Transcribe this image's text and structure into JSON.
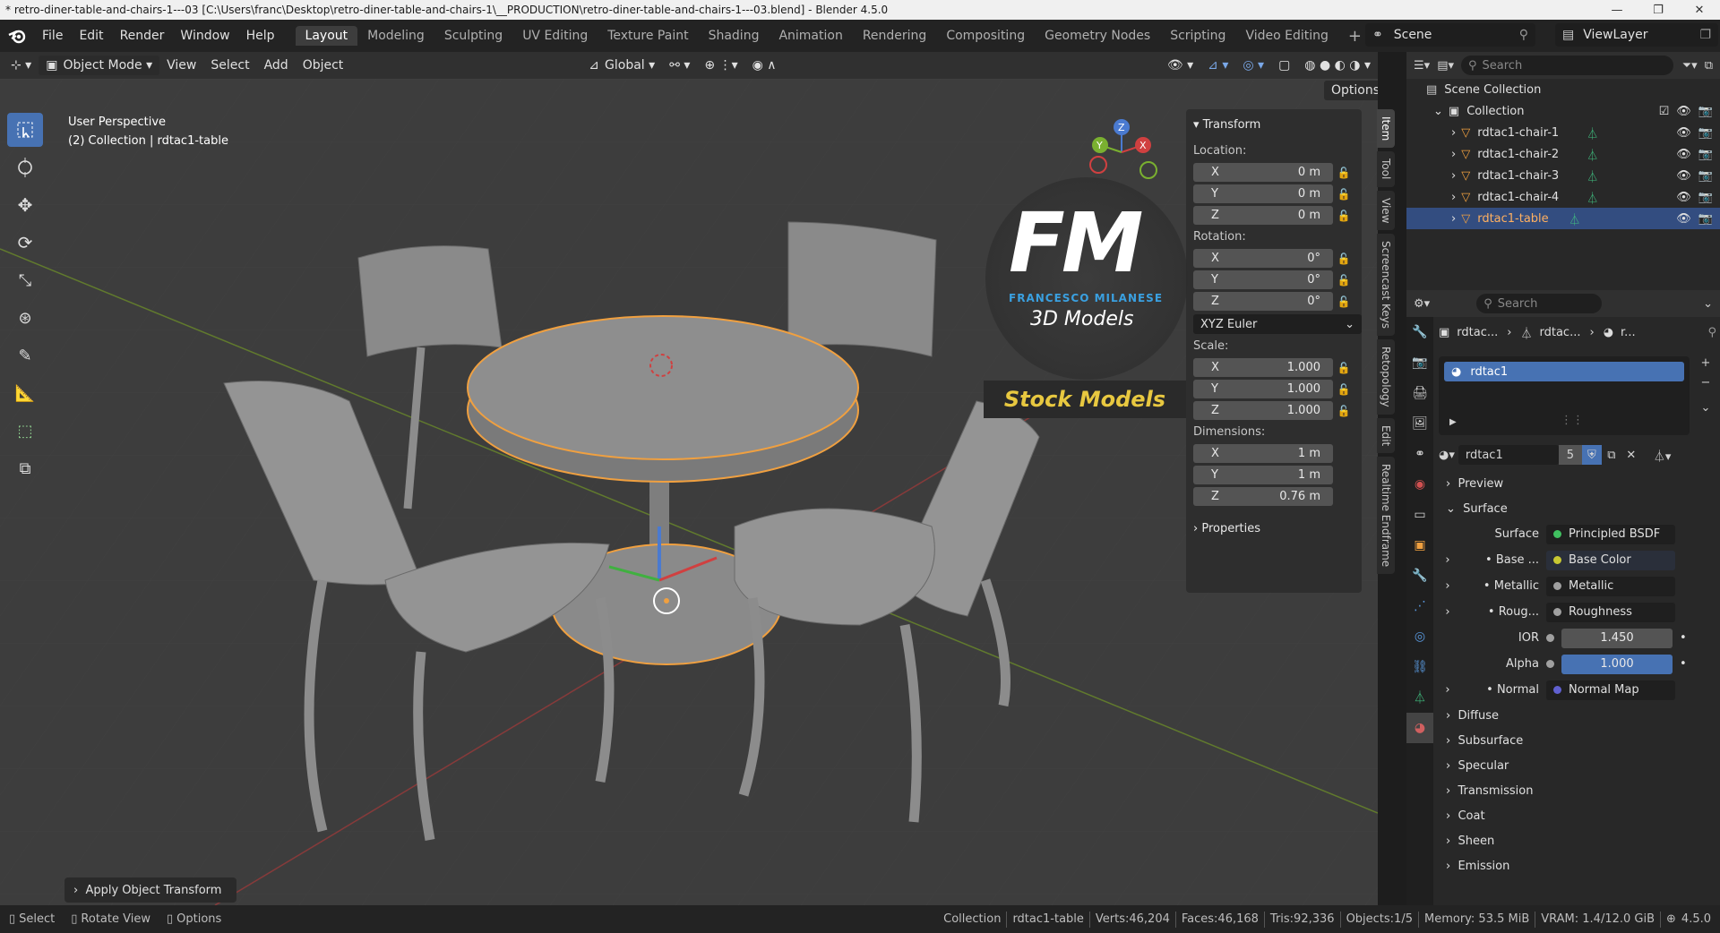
{
  "window": {
    "title": "* retro-diner-table-and-chairs-1---03 [C:\\Users\\franc\\Desktop\\retro-diner-table-and-chairs-1\\__PRODUCTION\\retro-diner-table-and-chairs-1---03.blend] - Blender 4.5.0"
  },
  "menu": {
    "file": "File",
    "edit": "Edit",
    "render": "Render",
    "window": "Window",
    "help": "Help"
  },
  "workspaces": [
    "Layout",
    "Modeling",
    "Sculpting",
    "UV Editing",
    "Texture Paint",
    "Shading",
    "Animation",
    "Rendering",
    "Compositing",
    "Geometry Nodes",
    "Scripting",
    "Video Editing"
  ],
  "scene": {
    "name": "Scene",
    "view_layer": "ViewLayer"
  },
  "header": {
    "mode": "Object Mode",
    "view": "View",
    "select": "Select",
    "add": "Add",
    "object": "Object",
    "orientation": "Global",
    "options": "Options"
  },
  "viewport": {
    "perspective": "User Perspective",
    "context": "(2) Collection | rdtac1-table",
    "toast": "Apply Object Transform",
    "watermark": {
      "logo": "FM",
      "brand": "FRANCESCO MILANESE",
      "sub": "3D Models",
      "tag": "Stock Models"
    }
  },
  "gizmo": {
    "x": "X",
    "y": "Y",
    "z": "Z"
  },
  "transform": {
    "title": "Transform",
    "location_label": "Location:",
    "location": [
      {
        "axis": "X",
        "value": "0 m"
      },
      {
        "axis": "Y",
        "value": "0 m"
      },
      {
        "axis": "Z",
        "value": "0 m"
      }
    ],
    "rotation_label": "Rotation:",
    "rotation": [
      {
        "axis": "X",
        "value": "0°"
      },
      {
        "axis": "Y",
        "value": "0°"
      },
      {
        "axis": "Z",
        "value": "0°"
      }
    ],
    "rotation_mode": "XYZ Euler",
    "scale_label": "Scale:",
    "scale": [
      {
        "axis": "X",
        "value": "1.000"
      },
      {
        "axis": "Y",
        "value": "1.000"
      },
      {
        "axis": "Z",
        "value": "1.000"
      }
    ],
    "dimensions_label": "Dimensions:",
    "dimensions": [
      {
        "axis": "X",
        "value": "1 m"
      },
      {
        "axis": "Y",
        "value": "1 m"
      },
      {
        "axis": "Z",
        "value": "0.76 m"
      }
    ],
    "properties": "Properties"
  },
  "side_tabs": [
    "Item",
    "Tool",
    "View",
    "Screencast Keys",
    "Retopology",
    "Edit",
    "Realtime Endframe"
  ],
  "outliner": {
    "search_placeholder": "Search",
    "scene_collection": "Scene Collection",
    "collection": "Collection",
    "items": [
      "rdtac1-chair-1",
      "rdtac1-chair-2",
      "rdtac1-chair-3",
      "rdtac1-chair-4",
      "rdtac1-table"
    ]
  },
  "properties": {
    "search_placeholder": "Search",
    "breadcrumb": [
      "rdtac...",
      "rdtac...",
      "r..."
    ],
    "material_slot": "rdtac1",
    "material_name": "rdtac1",
    "users": "5",
    "sections": {
      "preview": "Preview",
      "surface": "Surface"
    },
    "surface_shader_label": "Surface",
    "surface_shader": "Principled BSDF",
    "inputs": [
      {
        "label": "Base ...",
        "value": "Base Color",
        "color": "#c8c832"
      },
      {
        "label": "Metallic",
        "value": "Metallic",
        "color": "#a0a0a0"
      },
      {
        "label": "Roug...",
        "value": "Roughness",
        "color": "#a0a0a0"
      }
    ],
    "ior": {
      "label": "IOR",
      "value": "1.450"
    },
    "alpha": {
      "label": "Alpha",
      "value": "1.000"
    },
    "normal": {
      "label": "Normal",
      "value": "Normal Map"
    },
    "subsections": [
      "Diffuse",
      "Subsurface",
      "Specular",
      "Transmission",
      "Coat",
      "Sheen",
      "Emission"
    ]
  },
  "status": {
    "select": "Select",
    "rotate": "Rotate View",
    "options": "Options",
    "collection": "Collection",
    "object": "rdtac1-table",
    "verts": "Verts:46,204",
    "faces": "Faces:46,168",
    "tris": "Tris:92,336",
    "objects": "Objects:1/5",
    "memory": "Memory: 53.5 MiB",
    "vram": "VRAM: 1.4/12.0 GiB",
    "version": "4.5.0"
  }
}
